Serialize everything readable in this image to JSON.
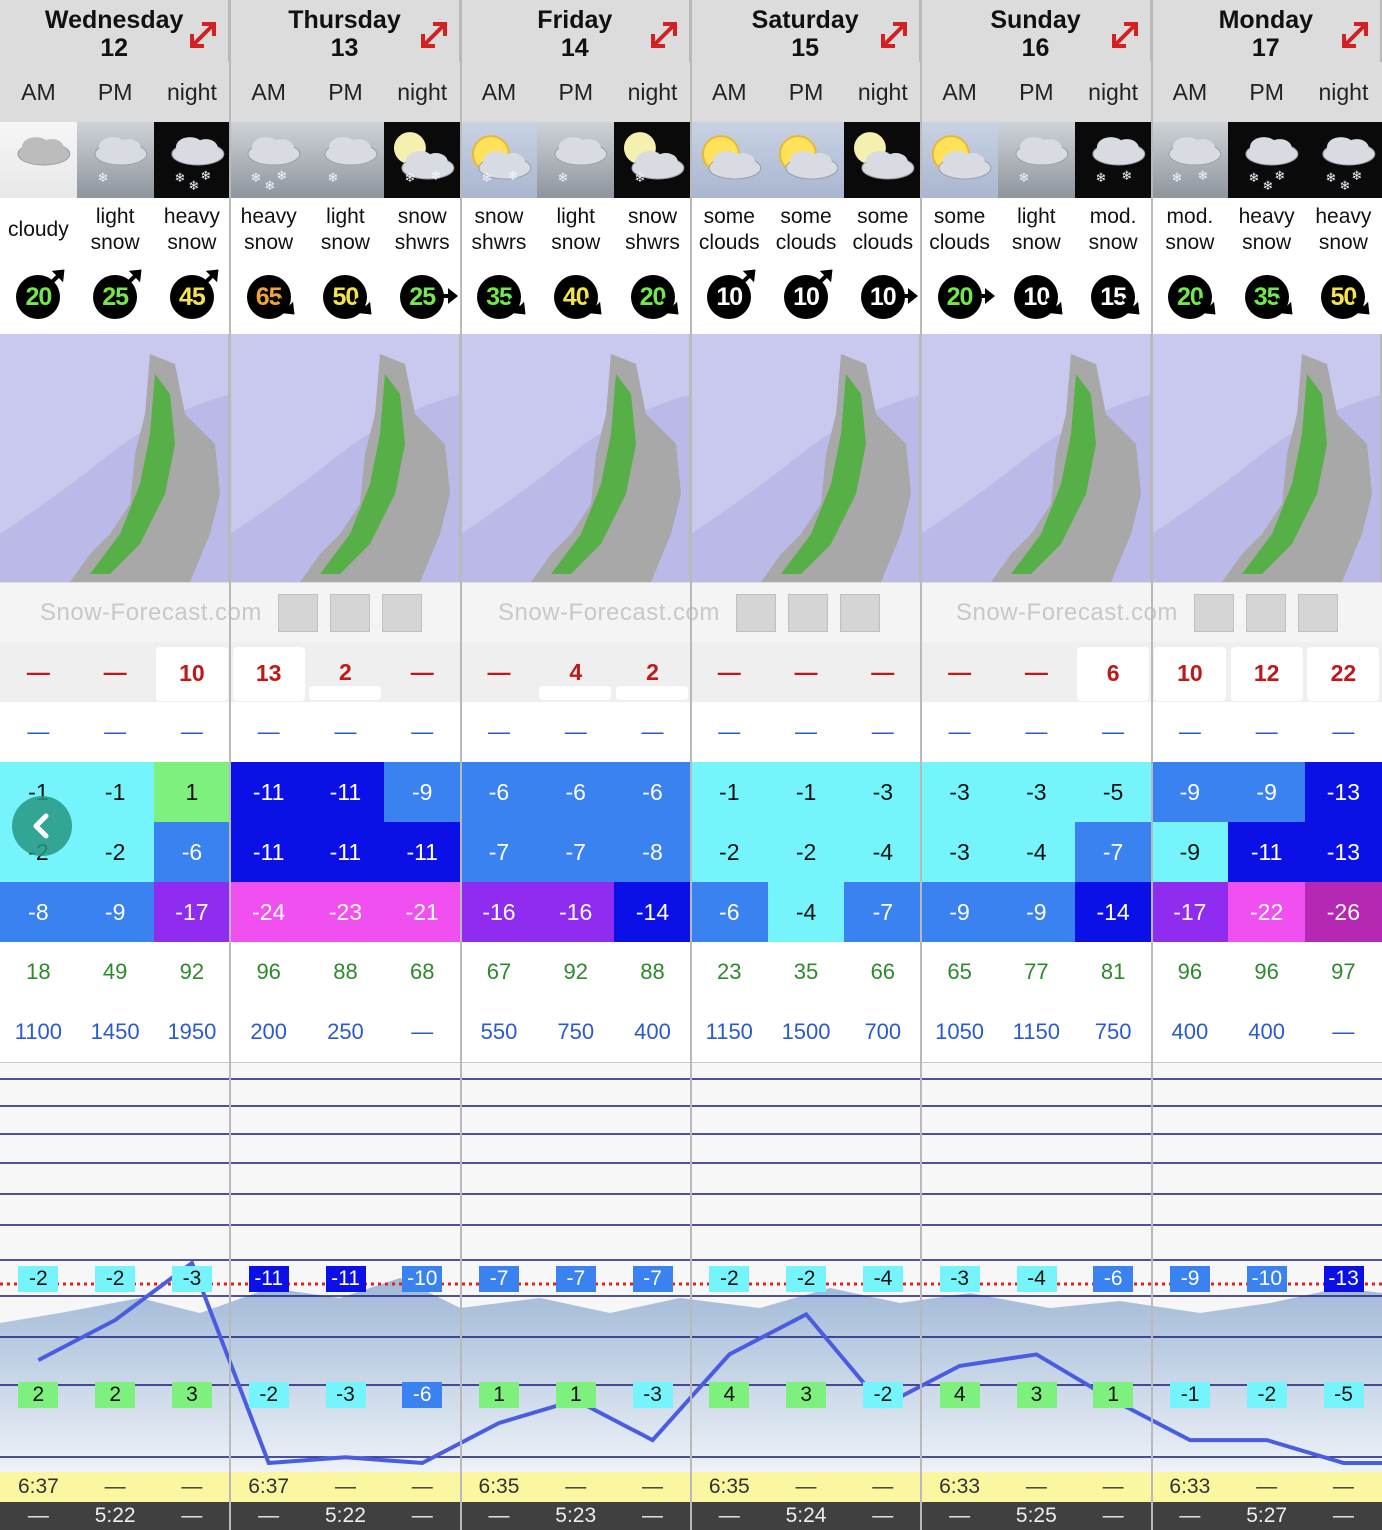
{
  "days": [
    {
      "name": "Wednesday",
      "num": "12"
    },
    {
      "name": "Thursday",
      "num": "13"
    },
    {
      "name": "Friday",
      "num": "14"
    },
    {
      "name": "Saturday",
      "num": "15"
    },
    {
      "name": "Sunday",
      "num": "16"
    },
    {
      "name": "Monday",
      "num": "17"
    }
  ],
  "periods": [
    "AM",
    "PM",
    "night",
    "AM",
    "PM",
    "night",
    "AM",
    "PM",
    "night",
    "AM",
    "PM",
    "night",
    "AM",
    "PM",
    "night",
    "AM",
    "PM",
    "night"
  ],
  "icons": [
    {
      "name": "cloudy-icon",
      "sky": "day-sky",
      "sun": false,
      "moon": false,
      "flakes": 0
    },
    {
      "name": "light-snow-icon",
      "sky": "gray-sky",
      "sun": false,
      "moon": false,
      "flakes": 1
    },
    {
      "name": "heavy-snow-icon",
      "sky": "dark-sky",
      "sun": false,
      "moon": false,
      "flakes": 3
    },
    {
      "name": "heavy-snow-icon",
      "sky": "gray-sky",
      "sun": false,
      "moon": false,
      "flakes": 3
    },
    {
      "name": "light-snow-icon",
      "sky": "gray-sky",
      "sun": false,
      "moon": false,
      "flakes": 1
    },
    {
      "name": "snow-showers-night-icon",
      "sky": "dark-sky",
      "sun": false,
      "moon": true,
      "flakes": 2
    },
    {
      "name": "snow-showers-icon",
      "sky": "sunny-sky",
      "sun": true,
      "moon": false,
      "flakes": 2
    },
    {
      "name": "light-snow-icon",
      "sky": "gray-sky",
      "sun": false,
      "moon": false,
      "flakes": 1
    },
    {
      "name": "snow-showers-night-icon",
      "sky": "dark-sky",
      "sun": false,
      "moon": true,
      "flakes": 1
    },
    {
      "name": "some-clouds-icon",
      "sky": "sunny-sky",
      "sun": true,
      "moon": false,
      "flakes": 0
    },
    {
      "name": "some-clouds-icon",
      "sky": "sunny-sky",
      "sun": true,
      "moon": false,
      "flakes": 0
    },
    {
      "name": "some-clouds-night-icon",
      "sky": "dark-sky",
      "sun": false,
      "moon": true,
      "flakes": 0
    },
    {
      "name": "some-clouds-icon",
      "sky": "sunny-sky",
      "sun": true,
      "moon": false,
      "flakes": 0
    },
    {
      "name": "light-snow-icon",
      "sky": "gray-sky",
      "sun": false,
      "moon": false,
      "flakes": 1
    },
    {
      "name": "moderate-snow-icon",
      "sky": "dark-sky",
      "sun": false,
      "moon": false,
      "flakes": 2
    },
    {
      "name": "moderate-snow-icon",
      "sky": "gray-sky",
      "sun": false,
      "moon": false,
      "flakes": 2
    },
    {
      "name": "heavy-snow-icon",
      "sky": "dark-sky",
      "sun": false,
      "moon": false,
      "flakes": 3
    },
    {
      "name": "heavy-snow-icon",
      "sky": "dark-sky",
      "sun": false,
      "moon": false,
      "flakes": 3
    }
  ],
  "summary": [
    [
      "cloudy"
    ],
    [
      "light",
      "snow"
    ],
    [
      "heavy",
      "snow"
    ],
    [
      "heavy",
      "snow"
    ],
    [
      "light",
      "snow"
    ],
    [
      "snow",
      "shwrs"
    ],
    [
      "snow",
      "shwrs"
    ],
    [
      "light",
      "snow"
    ],
    [
      "snow",
      "shwrs"
    ],
    [
      "some",
      "clouds"
    ],
    [
      "some",
      "clouds"
    ],
    [
      "some",
      "clouds"
    ],
    [
      "some",
      "clouds"
    ],
    [
      "light",
      "snow"
    ],
    [
      "mod.",
      "snow"
    ],
    [
      "mod.",
      "snow"
    ],
    [
      "heavy",
      "snow"
    ],
    [
      "heavy",
      "snow"
    ]
  ],
  "wind": [
    {
      "speed": "20",
      "color": "#74e84a",
      "dir": "ne"
    },
    {
      "speed": "25",
      "color": "#74e84a",
      "dir": "ne"
    },
    {
      "speed": "45",
      "color": "#f5e34b",
      "dir": "ne"
    },
    {
      "speed": "65",
      "color": "#f0a23c",
      "dir": "se"
    },
    {
      "speed": "50",
      "color": "#f5e34b",
      "dir": "se"
    },
    {
      "speed": "25",
      "color": "#74e84a",
      "dir": "e"
    },
    {
      "speed": "35",
      "color": "#74e84a",
      "dir": "se"
    },
    {
      "speed": "40",
      "color": "#f5e34b",
      "dir": "se"
    },
    {
      "speed": "20",
      "color": "#74e84a",
      "dir": "se"
    },
    {
      "speed": "10",
      "color": "#ffffff",
      "dir": "ne"
    },
    {
      "speed": "10",
      "color": "#ffffff",
      "dir": "ne"
    },
    {
      "speed": "10",
      "color": "#ffffff",
      "dir": "e"
    },
    {
      "speed": "20",
      "color": "#74e84a",
      "dir": "e"
    },
    {
      "speed": "10",
      "color": "#ffffff",
      "dir": "se"
    },
    {
      "speed": "15",
      "color": "#ffffff",
      "dir": "se"
    },
    {
      "speed": "20",
      "color": "#74e84a",
      "dir": "se"
    },
    {
      "speed": "35",
      "color": "#74e84a",
      "dir": "se"
    },
    {
      "speed": "50",
      "color": "#f5e34b",
      "dir": "se"
    }
  ],
  "brand": {
    "text": "Snow-Forecast.com"
  },
  "snow": [
    {
      "v": "—",
      "box": "none"
    },
    {
      "v": "—",
      "box": "none"
    },
    {
      "v": "10",
      "box": "full"
    },
    {
      "v": "13",
      "box": "full"
    },
    {
      "v": "2",
      "box": "bar"
    },
    {
      "v": "—",
      "box": "none"
    },
    {
      "v": "—",
      "box": "none"
    },
    {
      "v": "4",
      "box": "bar"
    },
    {
      "v": "2",
      "box": "bar"
    },
    {
      "v": "—",
      "box": "none"
    },
    {
      "v": "—",
      "box": "none"
    },
    {
      "v": "—",
      "box": "none"
    },
    {
      "v": "—",
      "box": "none"
    },
    {
      "v": "—",
      "box": "none"
    },
    {
      "v": "6",
      "box": "full"
    },
    {
      "v": "10",
      "box": "full"
    },
    {
      "v": "12",
      "box": "full"
    },
    {
      "v": "22",
      "box": "full"
    }
  ],
  "rain": [
    "—",
    "—",
    "—",
    "—",
    "—",
    "—",
    "—",
    "—",
    "—",
    "—",
    "—",
    "—",
    "—",
    "—",
    "—",
    "—",
    "—",
    "—"
  ],
  "temp_max": [
    {
      "v": "-1",
      "c": "tc-cyan"
    },
    {
      "v": "-1",
      "c": "tc-cyan"
    },
    {
      "v": "1",
      "c": "tc-green"
    },
    {
      "v": "-11",
      "c": "tc-navy"
    },
    {
      "v": "-11",
      "c": "tc-navy"
    },
    {
      "v": "-9",
      "c": "tc-blue"
    },
    {
      "v": "-6",
      "c": "tc-blue"
    },
    {
      "v": "-6",
      "c": "tc-blue"
    },
    {
      "v": "-6",
      "c": "tc-blue"
    },
    {
      "v": "-1",
      "c": "tc-cyan"
    },
    {
      "v": "-1",
      "c": "tc-cyan"
    },
    {
      "v": "-3",
      "c": "tc-cyan"
    },
    {
      "v": "-3",
      "c": "tc-cyan"
    },
    {
      "v": "-3",
      "c": "tc-cyan"
    },
    {
      "v": "-5",
      "c": "tc-cyan"
    },
    {
      "v": "-9",
      "c": "tc-blue"
    },
    {
      "v": "-9",
      "c": "tc-blue"
    },
    {
      "v": "-13",
      "c": "tc-navy"
    }
  ],
  "temp_min": [
    {
      "v": "-2",
      "c": "tc-cyan"
    },
    {
      "v": "-2",
      "c": "tc-cyan"
    },
    {
      "v": "-6",
      "c": "tc-blue"
    },
    {
      "v": "-11",
      "c": "tc-navy"
    },
    {
      "v": "-11",
      "c": "tc-navy"
    },
    {
      "v": "-11",
      "c": "tc-navy"
    },
    {
      "v": "-7",
      "c": "tc-blue"
    },
    {
      "v": "-7",
      "c": "tc-blue"
    },
    {
      "v": "-8",
      "c": "tc-blue"
    },
    {
      "v": "-2",
      "c": "tc-cyan"
    },
    {
      "v": "-2",
      "c": "tc-cyan"
    },
    {
      "v": "-4",
      "c": "tc-cyan"
    },
    {
      "v": "-3",
      "c": "tc-cyan"
    },
    {
      "v": "-4",
      "c": "tc-cyan"
    },
    {
      "v": "-7",
      "c": "tc-blue"
    },
    {
      "v": "-9",
      "c": "tc-cyan"
    },
    {
      "v": "-11",
      "c": "tc-navy"
    },
    {
      "v": "-13",
      "c": "tc-navy"
    }
  ],
  "temp_feels": [
    {
      "v": "-8",
      "c": "tc-blue"
    },
    {
      "v": "-9",
      "c": "tc-blue"
    },
    {
      "v": "-17",
      "c": "tc-purple"
    },
    {
      "v": "-24",
      "c": "tc-pink"
    },
    {
      "v": "-23",
      "c": "tc-pink"
    },
    {
      "v": "-21",
      "c": "tc-pink"
    },
    {
      "v": "-16",
      "c": "tc-purple"
    },
    {
      "v": "-16",
      "c": "tc-purple"
    },
    {
      "v": "-14",
      "c": "tc-navy"
    },
    {
      "v": "-6",
      "c": "tc-blue"
    },
    {
      "v": "-4",
      "c": "tc-cyan"
    },
    {
      "v": "-7",
      "c": "tc-blue"
    },
    {
      "v": "-9",
      "c": "tc-blue"
    },
    {
      "v": "-9",
      "c": "tc-blue"
    },
    {
      "v": "-14",
      "c": "tc-navy"
    },
    {
      "v": "-17",
      "c": "tc-purple"
    },
    {
      "v": "-22",
      "c": "tc-pink"
    },
    {
      "v": "-26",
      "c": "tc-plum"
    }
  ],
  "humidity": [
    "18",
    "49",
    "92",
    "96",
    "88",
    "68",
    "67",
    "92",
    "88",
    "23",
    "35",
    "66",
    "65",
    "77",
    "81",
    "96",
    "96",
    "97"
  ],
  "freezing_level": [
    "1100",
    "1450",
    "1950",
    "200",
    "250",
    "—",
    "550",
    "750",
    "400",
    "1150",
    "1500",
    "700",
    "1050",
    "1150",
    "750",
    "400",
    "400",
    "—"
  ],
  "chart": {
    "upper_labels": [
      {
        "v": "-2",
        "c": "#75f5fb"
      },
      {
        "v": "-2",
        "c": "#75f5fb"
      },
      {
        "v": "-3",
        "c": "#75f5fb"
      },
      {
        "v": "-11",
        "c": "#0a10e6"
      },
      {
        "v": "-11",
        "c": "#0a10e6"
      },
      {
        "v": "-10",
        "c": "#3a82f0"
      },
      {
        "v": "-7",
        "c": "#3a82f0"
      },
      {
        "v": "-7",
        "c": "#3a82f0"
      },
      {
        "v": "-7",
        "c": "#3a82f0"
      },
      {
        "v": "-2",
        "c": "#75f5fb"
      },
      {
        "v": "-2",
        "c": "#75f5fb"
      },
      {
        "v": "-4",
        "c": "#75f5fb"
      },
      {
        "v": "-3",
        "c": "#75f5fb"
      },
      {
        "v": "-4",
        "c": "#75f5fb"
      },
      {
        "v": "-6",
        "c": "#3a82f0"
      },
      {
        "v": "-9",
        "c": "#3a82f0"
      },
      {
        "v": "-10",
        "c": "#3a82f0"
      },
      {
        "v": "-13",
        "c": "#0a10e6"
      }
    ],
    "lower_labels": [
      {
        "v": "2",
        "c": "#7ef07e"
      },
      {
        "v": "2",
        "c": "#7ef07e"
      },
      {
        "v": "3",
        "c": "#7ef07e"
      },
      {
        "v": "-2",
        "c": "#75f5fb"
      },
      {
        "v": "-3",
        "c": "#75f5fb"
      },
      {
        "v": "-6",
        "c": "#3a82f0"
      },
      {
        "v": "1",
        "c": "#7ef07e"
      },
      {
        "v": "1",
        "c": "#7ef07e"
      },
      {
        "v": "-3",
        "c": "#75f5fb"
      },
      {
        "v": "4",
        "c": "#7ef07e"
      },
      {
        "v": "3",
        "c": "#7ef07e"
      },
      {
        "v": "-2",
        "c": "#75f5fb"
      },
      {
        "v": "4",
        "c": "#7ef07e"
      },
      {
        "v": "3",
        "c": "#7ef07e"
      },
      {
        "v": "1",
        "c": "#7ef07e"
      },
      {
        "v": "-1",
        "c": "#75f5fb"
      },
      {
        "v": "-2",
        "c": "#75f5fb"
      },
      {
        "v": "-5",
        "c": "#75f5fb"
      }
    ],
    "freezing_level_m": [
      1100,
      1450,
      1950,
      200,
      250,
      null,
      550,
      750,
      400,
      1150,
      1500,
      700,
      1050,
      1150,
      750,
      400,
      400,
      null
    ]
  },
  "sunrise": [
    "6:37",
    "—",
    "—",
    "6:37",
    "—",
    "—",
    "6:35",
    "—",
    "—",
    "6:35",
    "—",
    "—",
    "6:33",
    "—",
    "—",
    "6:33",
    "—",
    "—"
  ],
  "sunset": [
    "—",
    "5:22",
    "—",
    "—",
    "5:22",
    "—",
    "—",
    "5:23",
    "—",
    "—",
    "5:24",
    "—",
    "—",
    "5:25",
    "—",
    "—",
    "5:27",
    "—"
  ]
}
